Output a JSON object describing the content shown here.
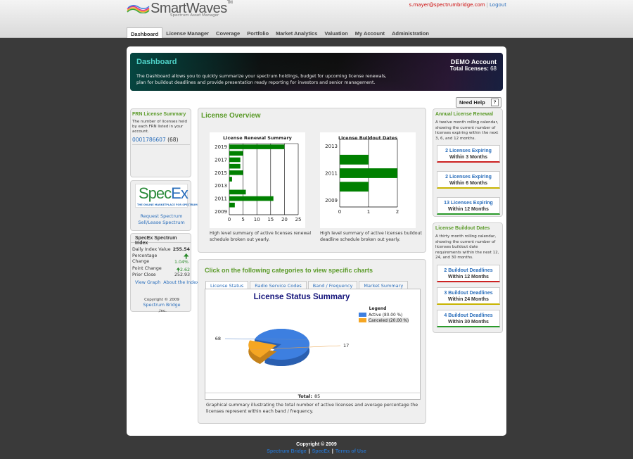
{
  "app": {
    "brand": "SmartWaves",
    "tm": "TM",
    "subtitle": "Spectrum Asset Manager"
  },
  "user": {
    "email": "s.mayer@spectrumbridge.com",
    "separator": "|",
    "logout": "Logout"
  },
  "nav": [
    {
      "label": "Dashboard",
      "active": true
    },
    {
      "label": "License Manager"
    },
    {
      "label": "Coverage"
    },
    {
      "label": "Portfolio"
    },
    {
      "label": "Market Analytics"
    },
    {
      "label": "Valuation"
    },
    {
      "label": "My Account"
    },
    {
      "label": "Administration"
    }
  ],
  "hero": {
    "title": "Dashboard",
    "description": "The Dashboard allows you to quickly summarize your spectrum holdings, budget for upcoming license renewals, plan for buildout deadlines and provide presentation ready reporting for investors and senior management.",
    "account": "DEMO Account",
    "total_label": "Total licenses:",
    "total_value": "68"
  },
  "need_help": {
    "label": "Need Help",
    "icon": "?"
  },
  "frn": {
    "title": "FRN License Summary",
    "desc": "The number of licenses held by each FRN listed in your account.",
    "frn_number": "0001786607",
    "frn_count": "(68)"
  },
  "specex": {
    "logo_main": "Spec",
    "logo_x": "Ex",
    "logo_tag": "THE ONLINE MARKETPLACE FOR SPECTRUM",
    "link1": "Request Spectrum",
    "link2": "Sell/Lease Spectrum"
  },
  "spectrum_index": {
    "title": "SpecEx Spectrum Index",
    "rows": [
      {
        "label": "Daily Index Value",
        "value": "255.54"
      },
      {
        "label": "Percentage Change",
        "value": "1.04%"
      },
      {
        "label": "Point Change",
        "value": "2.62"
      },
      {
        "label": "Prior Close",
        "value": "252.93"
      }
    ],
    "link_graph": "View Graph",
    "link_about": "About the Index",
    "copyright": "Copyright © 2009",
    "copyright_link": "Spectrum Bridge",
    "copyright_suffix": ",Inc."
  },
  "overview": {
    "title": "License Overview",
    "caption_renewal": "High level summary of active licenses renewal schedule broken out yearly.",
    "caption_buildout": "High level summary of active licenses buildout deadline schedule broken out yearly."
  },
  "categories": {
    "title": "Click on the following categories to view specific charts",
    "tabs": [
      {
        "label": "License Status",
        "active": true
      },
      {
        "label": "Radio Service Codes"
      },
      {
        "label": "Band / Frequency"
      },
      {
        "label": "Market Summary"
      }
    ],
    "caption": "Graphical summary illustrating the total number of active licenses and average percentage the licenses represent within each band / frequency."
  },
  "renewal": {
    "title": "Annual License Renewal",
    "desc": "A twelve month rolling calendar, showing the current number of licenses expiring within the next 3, 6, and 12 months.",
    "buttons": [
      {
        "line1": "2 Licenses Expiring",
        "line2": "Within 3 Months",
        "color": "#cc2222"
      },
      {
        "line1": "2 Licenses Expiring",
        "line2": "Within 6 Months",
        "color": "#c8b400"
      },
      {
        "line1": "13 Licenses Expiring",
        "line2": "Within 12 Months",
        "color": "#2a9a2a"
      }
    ]
  },
  "buildout": {
    "title": "License Buildout Dates",
    "desc": "A thirty month rolling calendar, showing the current number of licenses buildout date requirements within the next 12, 24, and 30 months.",
    "buttons": [
      {
        "line1": "2 Buildout Deadlines",
        "line2": "Within 12 Months",
        "color": "#cc2222"
      },
      {
        "line1": "3 Buildout Deadlines",
        "line2": "Within 24 Months",
        "color": "#c8b400"
      },
      {
        "line1": "4 Buildout Deadlines",
        "line2": "Within 30 Months",
        "color": "#2a9a2a"
      }
    ]
  },
  "footer": {
    "copyright": "Copyright © 2009",
    "links": [
      "Spectrum Bridge",
      "SpecEx",
      "Terms of Use"
    ]
  },
  "chart_data": [
    {
      "type": "bar",
      "orientation": "horizontal",
      "title": "License Renewal Summary",
      "categories": [
        "2019",
        "2018",
        "2017",
        "2016",
        "2015",
        "2014",
        "2013",
        "2012",
        "2011",
        "2010",
        "2009"
      ],
      "y_tick_labels": [
        "2019",
        "2017",
        "2015",
        "2013",
        "2011",
        "2009"
      ],
      "values": [
        20,
        5,
        4,
        4,
        5,
        1,
        0,
        6,
        16,
        2,
        0
      ],
      "xlim": [
        0,
        25
      ],
      "x_ticks": [
        0,
        5,
        10,
        15,
        20,
        25
      ],
      "grid": true,
      "color": "#008000"
    },
    {
      "type": "bar",
      "orientation": "horizontal",
      "title": "License Buildout Dates",
      "categories": [
        "2013",
        "2012",
        "2011",
        "2010",
        "2009"
      ],
      "y_tick_labels": [
        "2013",
        "2011",
        "2009"
      ],
      "values": [
        0,
        1,
        2,
        1,
        0
      ],
      "xlim": [
        0,
        2
      ],
      "x_ticks": [
        0,
        1,
        2
      ],
      "grid": true,
      "color": "#008000"
    },
    {
      "type": "pie",
      "style": "3d",
      "title": "License Status Summary",
      "legend_title": "Legend",
      "legend_position": "top-right",
      "slices": [
        {
          "label": "Active (80.00 %)",
          "value": 68,
          "color": "#3d7fe0"
        },
        {
          "label": "Canceled (20.00 %)",
          "value": 17,
          "color": "#f5a623"
        }
      ],
      "total_label": "Total:",
      "total_value": "85"
    }
  ]
}
